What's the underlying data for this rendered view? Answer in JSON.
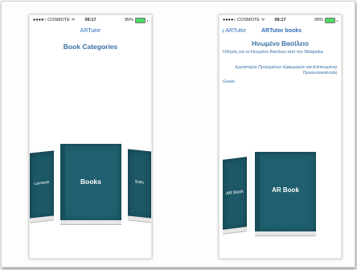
{
  "left_screen": {
    "status": {
      "carrier": "●●●●○ COSMOTE ᯤ",
      "time": "09:17",
      "battery": "95%"
    },
    "nav_title": "ARTutor",
    "heading": "Book Categories",
    "books": {
      "left_partial": "Lactante",
      "center": "Books",
      "right_partial": "Bulls"
    }
  },
  "right_screen": {
    "status": {
      "carrier": "●●●●○ COSMOTE ᯤ",
      "time": "09:17",
      "battery": "99%"
    },
    "back_label": "ARTutor",
    "nav_title": "ARTutor books",
    "title": "Ηνωμένο Βασίλειο",
    "description": "Οδηγός για το Ηνωμένο Βασίλειο από την Wikipedia",
    "author": "Εργαστήριο Προηγμένων Εφαρμογών και Επιτευγμένης Προσωποκτόνητας",
    "language": "Greek",
    "books": {
      "left_partial": "AR Book",
      "center": "AR Book"
    }
  },
  "colors": {
    "book_cover": "#1f5f6e",
    "accent": "#2c6fb8",
    "title_text": "#3a6fa6"
  }
}
